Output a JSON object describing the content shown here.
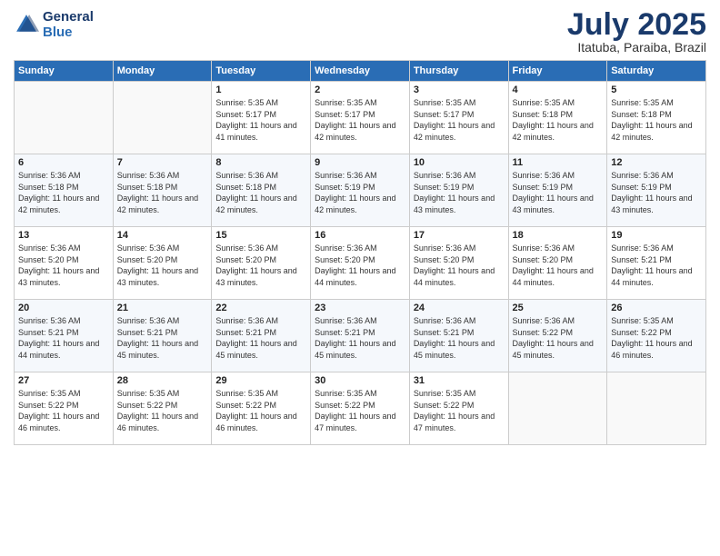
{
  "logo": {
    "line1": "General",
    "line2": "Blue"
  },
  "title": "July 2025",
  "subtitle": "Itatuba, Paraiba, Brazil",
  "columns": [
    "Sunday",
    "Monday",
    "Tuesday",
    "Wednesday",
    "Thursday",
    "Friday",
    "Saturday"
  ],
  "weeks": [
    [
      {
        "day": "",
        "info": ""
      },
      {
        "day": "",
        "info": ""
      },
      {
        "day": "1",
        "info": "Sunrise: 5:35 AM\nSunset: 5:17 PM\nDaylight: 11 hours and 41 minutes."
      },
      {
        "day": "2",
        "info": "Sunrise: 5:35 AM\nSunset: 5:17 PM\nDaylight: 11 hours and 42 minutes."
      },
      {
        "day": "3",
        "info": "Sunrise: 5:35 AM\nSunset: 5:17 PM\nDaylight: 11 hours and 42 minutes."
      },
      {
        "day": "4",
        "info": "Sunrise: 5:35 AM\nSunset: 5:18 PM\nDaylight: 11 hours and 42 minutes."
      },
      {
        "day": "5",
        "info": "Sunrise: 5:35 AM\nSunset: 5:18 PM\nDaylight: 11 hours and 42 minutes."
      }
    ],
    [
      {
        "day": "6",
        "info": "Sunrise: 5:36 AM\nSunset: 5:18 PM\nDaylight: 11 hours and 42 minutes."
      },
      {
        "day": "7",
        "info": "Sunrise: 5:36 AM\nSunset: 5:18 PM\nDaylight: 11 hours and 42 minutes."
      },
      {
        "day": "8",
        "info": "Sunrise: 5:36 AM\nSunset: 5:18 PM\nDaylight: 11 hours and 42 minutes."
      },
      {
        "day": "9",
        "info": "Sunrise: 5:36 AM\nSunset: 5:19 PM\nDaylight: 11 hours and 42 minutes."
      },
      {
        "day": "10",
        "info": "Sunrise: 5:36 AM\nSunset: 5:19 PM\nDaylight: 11 hours and 43 minutes."
      },
      {
        "day": "11",
        "info": "Sunrise: 5:36 AM\nSunset: 5:19 PM\nDaylight: 11 hours and 43 minutes."
      },
      {
        "day": "12",
        "info": "Sunrise: 5:36 AM\nSunset: 5:19 PM\nDaylight: 11 hours and 43 minutes."
      }
    ],
    [
      {
        "day": "13",
        "info": "Sunrise: 5:36 AM\nSunset: 5:20 PM\nDaylight: 11 hours and 43 minutes."
      },
      {
        "day": "14",
        "info": "Sunrise: 5:36 AM\nSunset: 5:20 PM\nDaylight: 11 hours and 43 minutes."
      },
      {
        "day": "15",
        "info": "Sunrise: 5:36 AM\nSunset: 5:20 PM\nDaylight: 11 hours and 43 minutes."
      },
      {
        "day": "16",
        "info": "Sunrise: 5:36 AM\nSunset: 5:20 PM\nDaylight: 11 hours and 44 minutes."
      },
      {
        "day": "17",
        "info": "Sunrise: 5:36 AM\nSunset: 5:20 PM\nDaylight: 11 hours and 44 minutes."
      },
      {
        "day": "18",
        "info": "Sunrise: 5:36 AM\nSunset: 5:20 PM\nDaylight: 11 hours and 44 minutes."
      },
      {
        "day": "19",
        "info": "Sunrise: 5:36 AM\nSunset: 5:21 PM\nDaylight: 11 hours and 44 minutes."
      }
    ],
    [
      {
        "day": "20",
        "info": "Sunrise: 5:36 AM\nSunset: 5:21 PM\nDaylight: 11 hours and 44 minutes."
      },
      {
        "day": "21",
        "info": "Sunrise: 5:36 AM\nSunset: 5:21 PM\nDaylight: 11 hours and 45 minutes."
      },
      {
        "day": "22",
        "info": "Sunrise: 5:36 AM\nSunset: 5:21 PM\nDaylight: 11 hours and 45 minutes."
      },
      {
        "day": "23",
        "info": "Sunrise: 5:36 AM\nSunset: 5:21 PM\nDaylight: 11 hours and 45 minutes."
      },
      {
        "day": "24",
        "info": "Sunrise: 5:36 AM\nSunset: 5:21 PM\nDaylight: 11 hours and 45 minutes."
      },
      {
        "day": "25",
        "info": "Sunrise: 5:36 AM\nSunset: 5:22 PM\nDaylight: 11 hours and 45 minutes."
      },
      {
        "day": "26",
        "info": "Sunrise: 5:35 AM\nSunset: 5:22 PM\nDaylight: 11 hours and 46 minutes."
      }
    ],
    [
      {
        "day": "27",
        "info": "Sunrise: 5:35 AM\nSunset: 5:22 PM\nDaylight: 11 hours and 46 minutes."
      },
      {
        "day": "28",
        "info": "Sunrise: 5:35 AM\nSunset: 5:22 PM\nDaylight: 11 hours and 46 minutes."
      },
      {
        "day": "29",
        "info": "Sunrise: 5:35 AM\nSunset: 5:22 PM\nDaylight: 11 hours and 46 minutes."
      },
      {
        "day": "30",
        "info": "Sunrise: 5:35 AM\nSunset: 5:22 PM\nDaylight: 11 hours and 47 minutes."
      },
      {
        "day": "31",
        "info": "Sunrise: 5:35 AM\nSunset: 5:22 PM\nDaylight: 11 hours and 47 minutes."
      },
      {
        "day": "",
        "info": ""
      },
      {
        "day": "",
        "info": ""
      }
    ]
  ]
}
